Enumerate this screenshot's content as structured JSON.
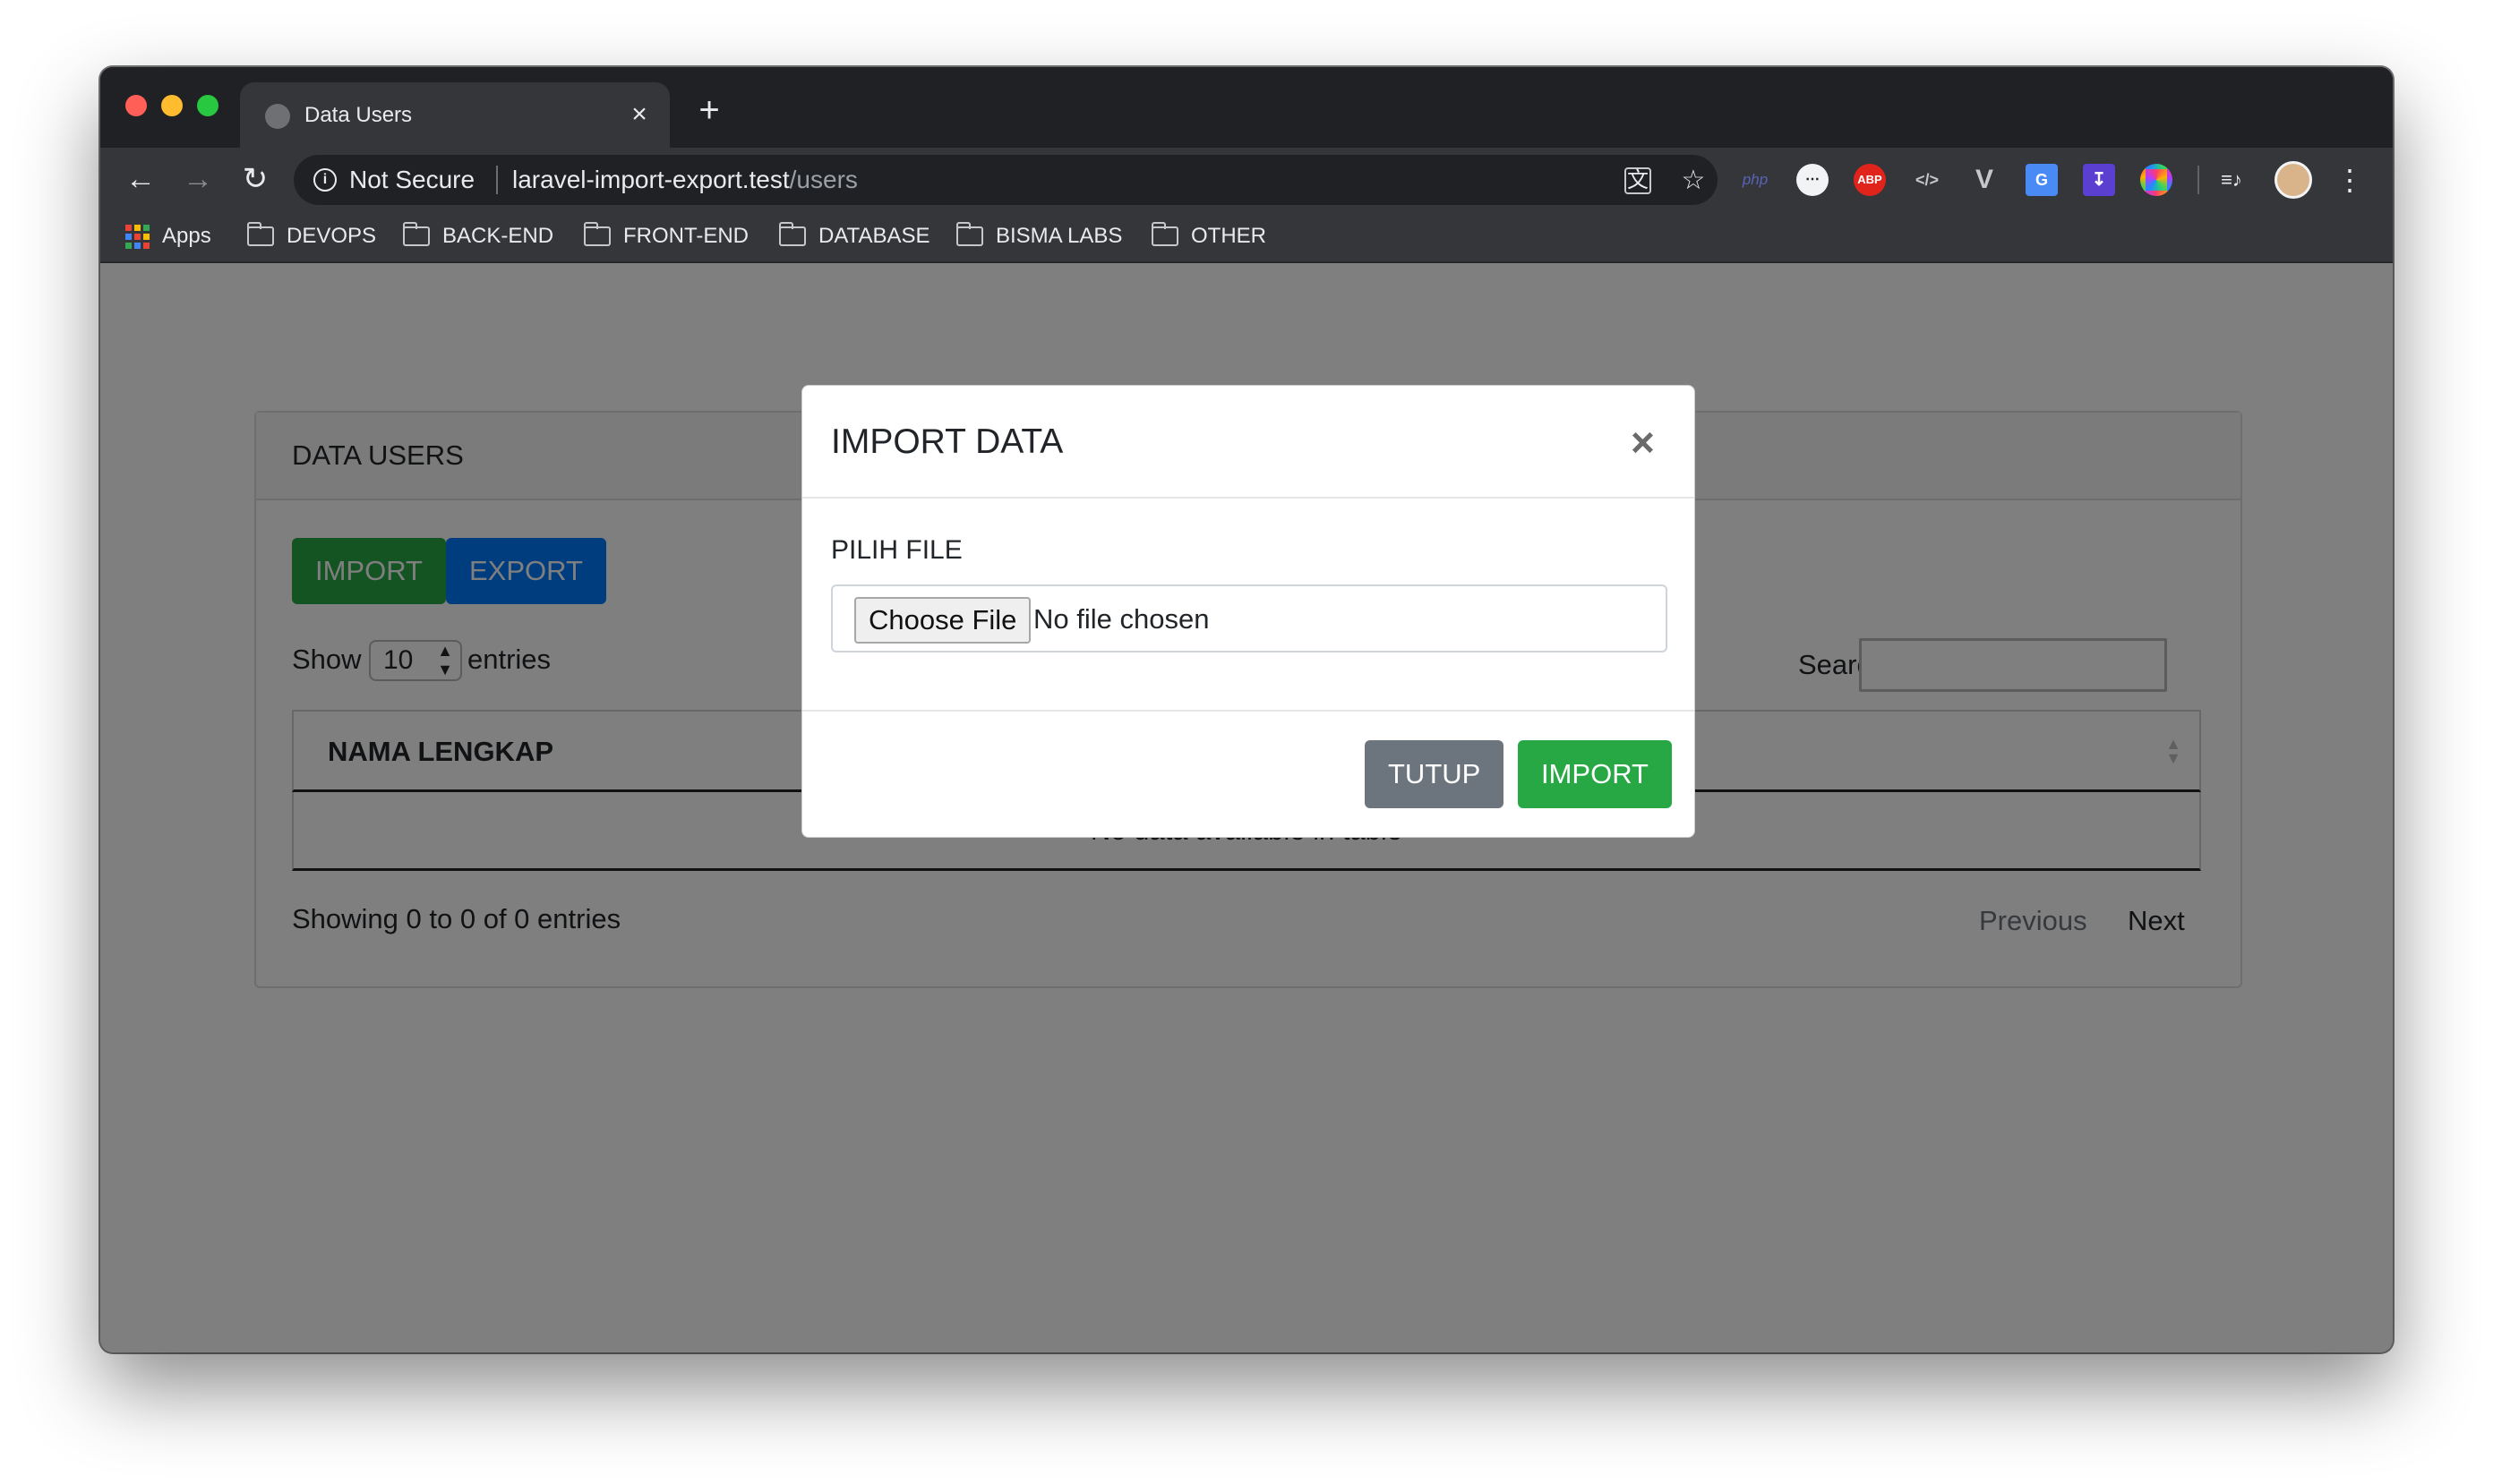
{
  "browser": {
    "tab_title": "Data Users",
    "tab_close": "×",
    "new_tab": "+",
    "back": "←",
    "forward": "→",
    "reload": "↻",
    "security_label": "Not Secure",
    "url_host": "laravel-import-export.test",
    "url_path": "/users",
    "translate_icon": "文",
    "star": "☆",
    "menu": "⋮",
    "bookmarks": [
      {
        "label": "Apps"
      },
      {
        "label": "DEVOPS"
      },
      {
        "label": "BACK-END"
      },
      {
        "label": "FRONT-END"
      },
      {
        "label": "DATABASE"
      },
      {
        "label": "BISMA LABS"
      },
      {
        "label": "OTHER"
      }
    ],
    "extensions": {
      "php": "php",
      "abp": "ABP",
      "code": "</>",
      "vue": "V",
      "media": "≡♪"
    }
  },
  "page": {
    "card_title": "DATA USERS",
    "import_button": "IMPORT",
    "export_button": "EXPORT",
    "show_label": "Show",
    "entries_value": "10",
    "entries_label": "entries",
    "search_label": "Search:",
    "column_name": "NAMA LENGKAP",
    "empty_message": "No data available in table",
    "showing_text": "Showing 0 to 0 of 0 entries",
    "previous": "Previous",
    "next": "Next"
  },
  "modal": {
    "title": "IMPORT DATA",
    "close": "×",
    "field_label": "PILIH FILE",
    "choose_file": "Choose File",
    "file_status": "No file chosen",
    "close_button": "TUTUP",
    "import_button": "IMPORT"
  },
  "colors": {
    "success": "#28a745",
    "primary": "#007bff",
    "secondary": "#6c757d"
  }
}
